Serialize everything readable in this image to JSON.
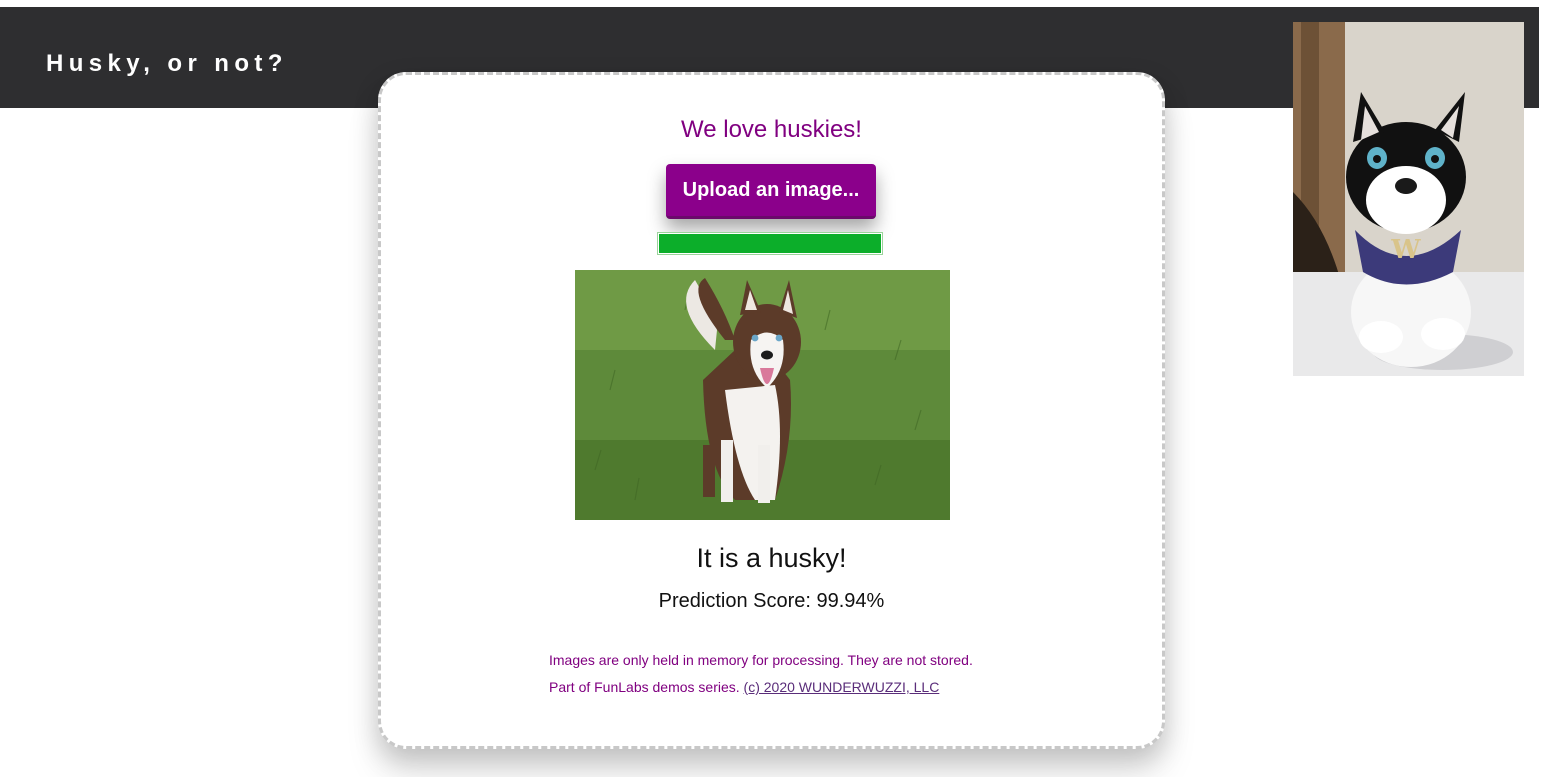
{
  "header": {
    "title": "Husky, or not?"
  },
  "mascot_image": {
    "icon": "husky-plush-mascot-photo",
    "bandana_letter": "W"
  },
  "card": {
    "headline": "We love huskies!",
    "upload_button_label": "Upload an image...",
    "progress_percent": 100,
    "uploaded_image": {
      "icon": "husky-dog-on-grass-photo"
    },
    "result_text": "It is a husky!",
    "score_text": "Prediction Score: 99.94%",
    "privacy_note": "Images are only held in memory for processing. They are not stored.",
    "series_note": "Part of FunLabs demos series.",
    "copyright_link": "(c) 2020 WUNDERWUZZI, LLC"
  },
  "colors": {
    "topbar": "#2e2e30",
    "accent_purple": "#8b008b",
    "text_purple": "#800080",
    "progress_green": "#0cae2a"
  }
}
